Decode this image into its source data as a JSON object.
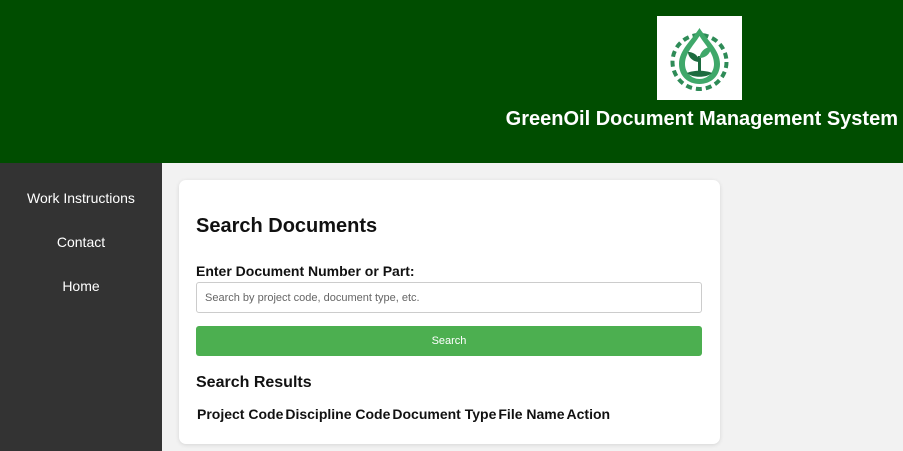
{
  "header": {
    "title": "GreenOil Document Management System",
    "logo": "leaf-drop-gear-logo"
  },
  "sidebar": {
    "items": [
      {
        "label": "Work Instructions"
      },
      {
        "label": "Contact"
      },
      {
        "label": "Home"
      }
    ]
  },
  "main": {
    "title": "Search Documents",
    "field_label": "Enter Document Number or Part:",
    "search": {
      "value": "",
      "placeholder": "Search by project code, document type, etc."
    },
    "search_button_label": "Search",
    "results_title": "Search Results",
    "columns": [
      "Project Code",
      "Discipline Code",
      "Document Type",
      "File Name",
      "Action"
    ]
  },
  "colors": {
    "header_bg": "#004d00",
    "sidebar_bg": "#333333",
    "button_green": "#4caf50",
    "page_bg": "#f2f2f2"
  }
}
